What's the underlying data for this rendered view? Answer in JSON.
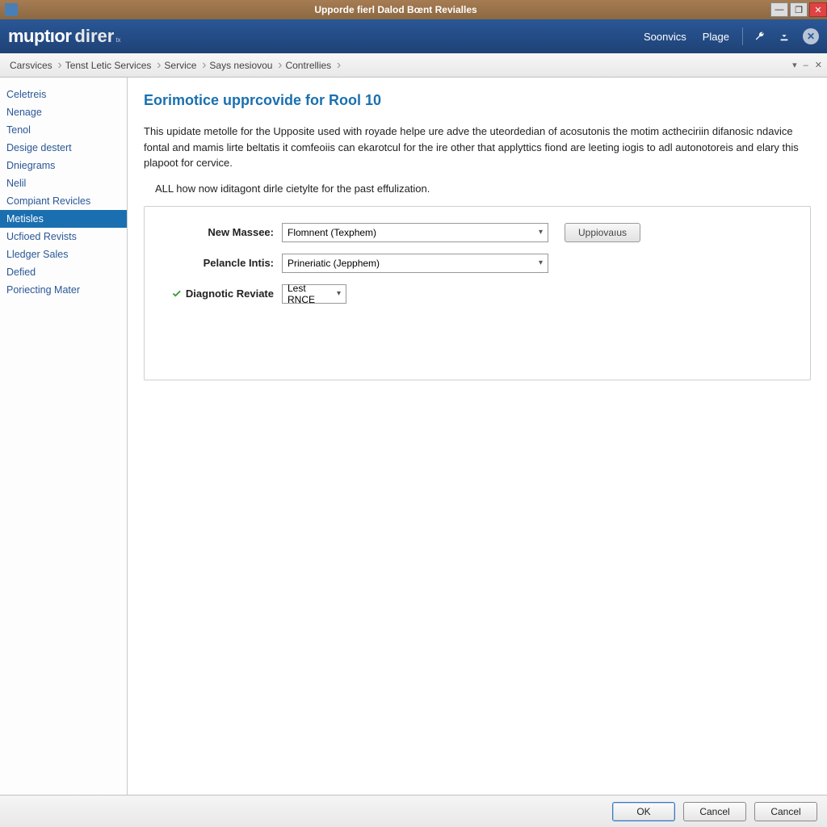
{
  "window": {
    "title": "Upporde fierl Dalod Bœnt Revialles"
  },
  "brand": {
    "a": "muptıor",
    "b": "direr",
    "sub": "tx"
  },
  "topbar": {
    "links": [
      "Soonvics",
      "Plage"
    ]
  },
  "breadcrumbs": [
    "Carsvices",
    "Tenst Letic Services",
    "Service",
    "Says nesiovou",
    "Contrellies"
  ],
  "sidebar": {
    "items": [
      "Celetreis",
      "Nenage",
      "Tenol",
      "Desige destert",
      "Dniegrams",
      "Nelil",
      "Compiant Revicles",
      "Metisles",
      "Ucfioed Revists",
      "Lledger Sales",
      "Defied",
      "Poriecting Mater"
    ],
    "active_index": 7
  },
  "page": {
    "title": "Eorimotice upprcovide for Rool 10",
    "description": "This upidate metolle for the Upposite used with royade helpe ure adve the uteordedian of acosutonis the motim actheciriin difanosic ndavice fontal and mamis lirte beltatis it comfeoiis can ekarotcul for the ire other that applyttics fiond are leeting iogis to adl autonotoreis and elary this plapoot for cervice.",
    "subdesc": "ALL how now iditagont dirle cietylte for the past effulization.",
    "form": {
      "rows": [
        {
          "label": "New Massee:",
          "value": "Flomnent (Texphem)",
          "width": "wide",
          "has_check": false
        },
        {
          "label": "Pelancle Intis:",
          "value": "Prineriatic (Jepphem)",
          "width": "wide",
          "has_check": false
        },
        {
          "label": "Diagnotic Reviate",
          "value": "Lest RNCE",
          "width": "narrow",
          "has_check": true
        }
      ],
      "update_button": "Uppiovaıus"
    }
  },
  "footer": {
    "ok": "OK",
    "cancel1": "Cancel",
    "cancel2": "Cancel"
  }
}
